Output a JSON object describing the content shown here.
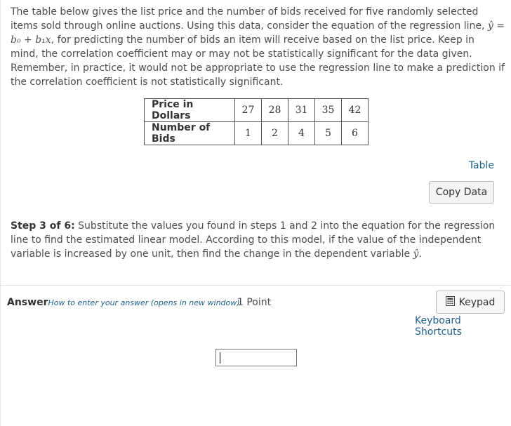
{
  "question": {
    "part1": "The table below gives the list price and the number of bids received for five randomly selected items sold through online auctions. Using this data, consider the equation of the regression line, ",
    "equation": "ŷ = b₀ + b₁x",
    "part2": ", for predicting the number of bids an item will receive based on the list price. Keep in mind, the correlation coefficient may or may not be statistically significant for the data given. Remember, in practice, it would not be appropriate to use the regression line to make a prediction if the correlation coefficient is not statistically significant."
  },
  "table": {
    "rows": [
      {
        "header": "Price in Dollars",
        "values": [
          "27",
          "28",
          "31",
          "35",
          "42"
        ]
      },
      {
        "header": "Number of Bids",
        "values": [
          "1",
          "2",
          "4",
          "5",
          "6"
        ]
      }
    ]
  },
  "links": {
    "table": "Table",
    "copy_data": "Copy Data",
    "how_to": "How to enter your answer (opens in new window)",
    "keyboard_shortcuts": "Keyboard Shortcuts"
  },
  "step": {
    "label": "Step 3 of 6:",
    "text": " Substitute the values you found in steps 1 and 2 into the equation for the regression line to find the estimated linear model. According to this model, if the value of the independent variable is increased by one unit, then find the change in the dependent variable ",
    "var": "ŷ",
    "end": "."
  },
  "answer": {
    "label": "Answer",
    "points": "1 Point",
    "keypad": "Keypad",
    "value": ""
  },
  "icons": {
    "keypad": "calculator-icon"
  }
}
